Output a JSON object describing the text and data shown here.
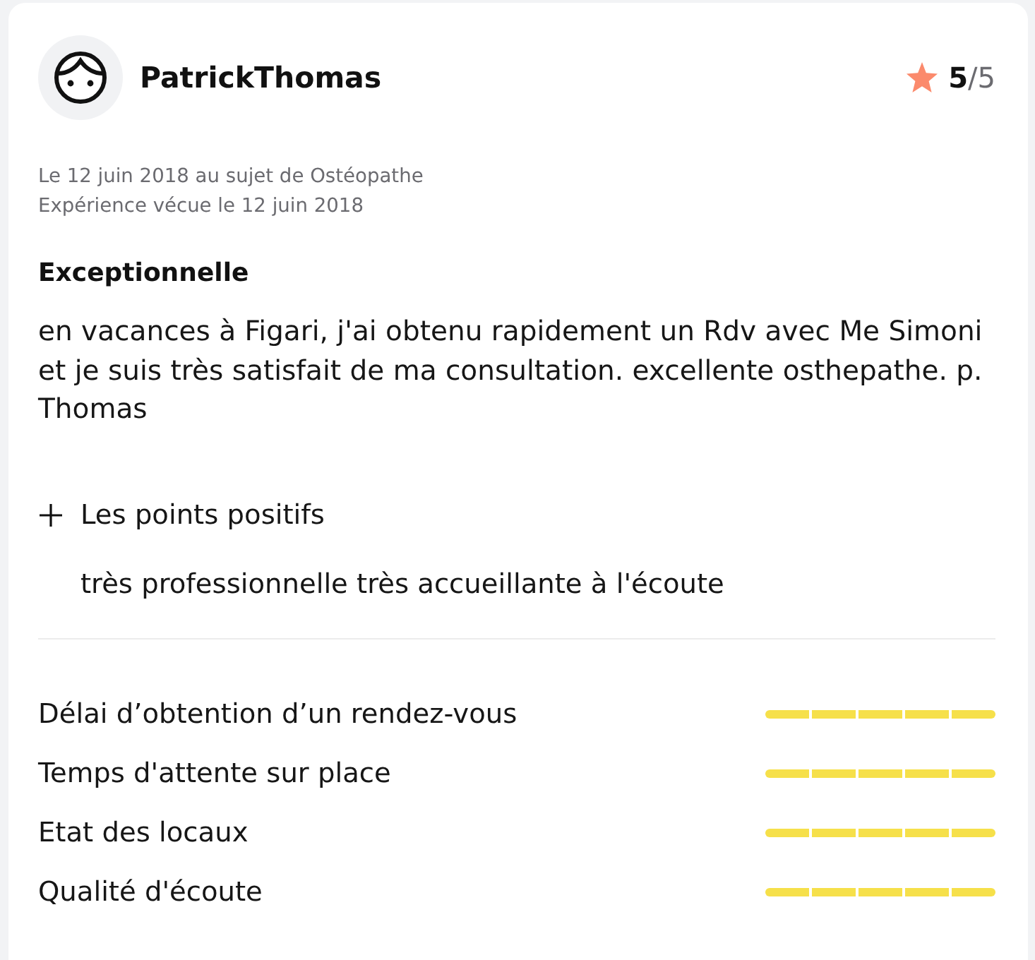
{
  "review": {
    "author": {
      "name": "PatrickThomas"
    },
    "score": "**5**/5",
    "meta": [
      "Le 12 juin 2018 au sujet de Ostéopathe",
      "Expérience vécue le 12 juin 2018"
    ],
    "title": "Exceptionnelle",
    "body": "en vacances à Figari, j'ai obtenu rapidement un Rdv avec Me Simoni et je suis très satisfait de ma consultation. excellente osthepathe. p. Thomas",
    "positives": {
      "heading": "Les points positifs",
      "text": "très professionnelle très accueillante à l'écoute"
    }
  },
  "criteria": [
    {
      "label": "Délai d’obtention d’un rendez-vous",
      "stars": 5
    },
    {
      "label": "Temps d'attente sur place",
      "stars": 5
    },
    {
      "label": "Etat des locaux",
      "stars": 5
    },
    {
      "label": "Qualité d'écoute",
      "stars": 5
    }
  ]
}
